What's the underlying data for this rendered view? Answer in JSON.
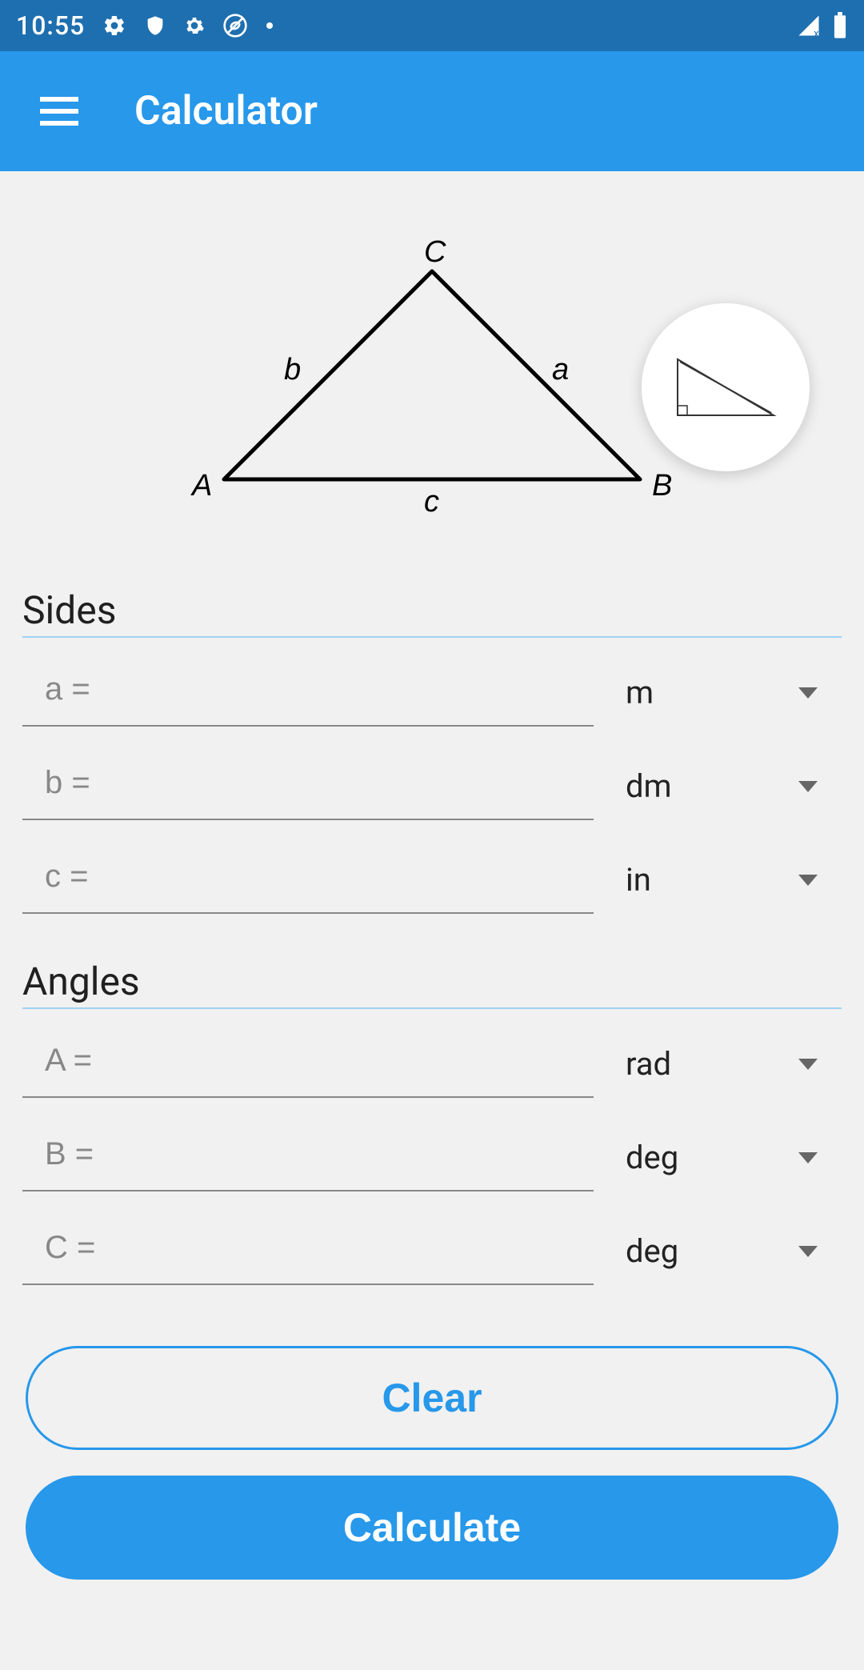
{
  "status": {
    "time": "10:55"
  },
  "appbar": {
    "title": "Calculator"
  },
  "diagram": {
    "vertex_top": "C",
    "vertex_left": "A",
    "vertex_right": "B",
    "side_left": "b",
    "side_right": "a",
    "side_bottom": "c"
  },
  "sections": {
    "sides_header": "Sides",
    "angles_header": "Angles"
  },
  "fields": {
    "side_a": {
      "placeholder": "a =",
      "unit": "m"
    },
    "side_b": {
      "placeholder": "b =",
      "unit": "dm"
    },
    "side_c": {
      "placeholder": "c =",
      "unit": "in"
    },
    "angle_A": {
      "placeholder": "A =",
      "unit": "rad"
    },
    "angle_B": {
      "placeholder": "B =",
      "unit": "deg"
    },
    "angle_C": {
      "placeholder": "C =",
      "unit": "deg"
    }
  },
  "buttons": {
    "clear": "Clear",
    "calculate": "Calculate"
  }
}
